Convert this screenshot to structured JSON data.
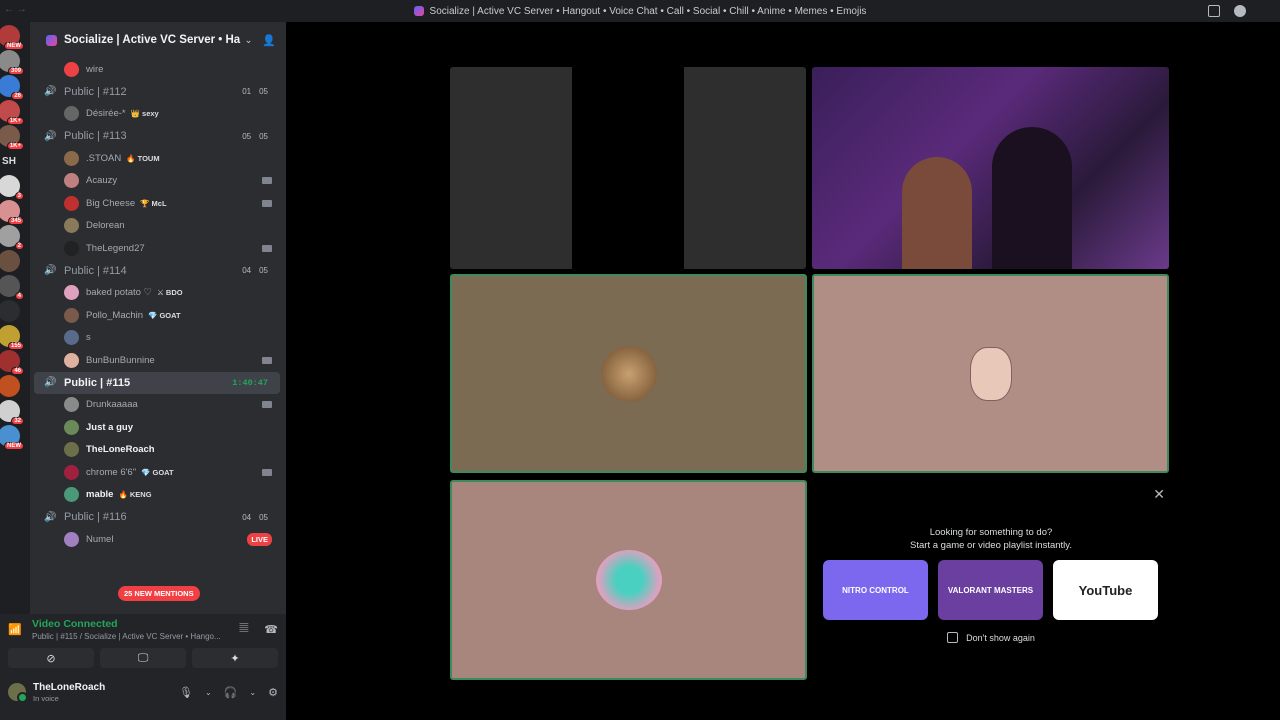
{
  "window": {
    "title": "Socialize | Active VC Server • Hangout • Voice Chat • Call • Social • Chill • Anime • Memes • Emojis"
  },
  "guilds": [
    {
      "badge": "NEW",
      "color": "#b13b3b"
    },
    {
      "badge": "309",
      "color": "#8a8a8a"
    },
    {
      "badge": "26",
      "color": "#3a7bd5"
    },
    {
      "badge": "1K+",
      "color": "#c24a4a"
    },
    {
      "badge": "1K+",
      "color": "#7a5a4a"
    },
    {
      "badge": "",
      "color": "#1e1f22",
      "text": "SH"
    },
    {
      "badge": "3",
      "color": "#d8d8d8"
    },
    {
      "badge": "345",
      "color": "#d89090"
    },
    {
      "badge": "2",
      "color": "#a0a0a0"
    },
    {
      "badge": "",
      "color": "#6a5040"
    },
    {
      "badge": "4",
      "color": "#555"
    },
    {
      "badge": "",
      "color": "#2b2d31"
    },
    {
      "badge": "155",
      "color": "#c0a030"
    },
    {
      "badge": "46",
      "color": "#a03030"
    },
    {
      "badge": "",
      "color": "#c05020"
    },
    {
      "badge": "32",
      "color": "#d0d0d0"
    },
    {
      "badge": "NEW",
      "color": "#4a90d0"
    }
  ],
  "sidebar": {
    "server_name": "Socialize | Active VC Server • Han...",
    "top_members": [
      {
        "name": "wire",
        "color": "#ed4245"
      }
    ],
    "channels": [
      {
        "name": "Public | #112",
        "count_a": "01",
        "count_b": "05",
        "members": [
          {
            "name": "Désirée-*",
            "tag": "👑 sexy",
            "color": "#666",
            "cam": false
          }
        ]
      },
      {
        "name": "Public | #113",
        "count_a": "05",
        "count_b": "05",
        "members": [
          {
            "name": ".STOAN",
            "tag": "🔥 TOUM",
            "color": "#8a6a4a",
            "cam": false
          },
          {
            "name": "Acauzy",
            "tag": "",
            "color": "#c08080",
            "cam": true
          },
          {
            "name": "Big Cheese",
            "tag": "🏆 McL",
            "color": "#c03030",
            "cam": true
          },
          {
            "name": "Delorean",
            "tag": "",
            "color": "#8a7a5a",
            "cam": false
          },
          {
            "name": "TheLegend27",
            "tag": "",
            "color": "#222",
            "cam": true
          }
        ]
      },
      {
        "name": "Public | #114",
        "count_a": "04",
        "count_b": "05",
        "members": [
          {
            "name": "baked potato ♡",
            "tag": "⚔ BDO",
            "color": "#e0a0c0",
            "cam": false
          },
          {
            "name": "Pollo_Machin",
            "tag": "💎 GOAT",
            "color": "#7a5a4a",
            "cam": false
          },
          {
            "name": "s",
            "tag": "",
            "color": "#5a6a8a",
            "cam": false
          },
          {
            "name": "BunBunBunnine",
            "tag": "",
            "color": "#e0b0a0",
            "cam": true
          }
        ]
      },
      {
        "name": "Public | #115",
        "timer": "1:40:47",
        "active": true,
        "members": [
          {
            "name": "Drunkaaaaa",
            "tag": "",
            "color": "#8a8a8a",
            "cam": true,
            "white": false
          },
          {
            "name": "Just a guy",
            "tag": "",
            "color": "#6a8a5a",
            "cam": false,
            "white": true
          },
          {
            "name": "TheLoneRoach",
            "tag": "",
            "color": "#6d6f4b",
            "cam": false,
            "white": true
          },
          {
            "name": "chrome 6'6\"",
            "tag": "💎 GOAT",
            "color": "#a02040",
            "cam": true,
            "white": false
          },
          {
            "name": "mable",
            "tag": "🔥 KENG",
            "color": "#4a9a7a",
            "cam": false,
            "white": true
          }
        ]
      },
      {
        "name": "Public | #116",
        "count_a": "04",
        "count_b": "05",
        "members": [
          {
            "name": "Numel",
            "tag": "",
            "color": "#a080c0",
            "live": "LIVE"
          }
        ]
      }
    ],
    "mentions_pill": "25 NEW MENTIONS"
  },
  "voice": {
    "status": "Video Connected",
    "location": "Public | #115 / Socialize | Active VC Server • Hango..."
  },
  "user": {
    "name": "TheLoneRoach",
    "status": "In voice"
  },
  "activity": {
    "line1": "Looking for something to do?",
    "line2": "Start a game or video playlist instantly.",
    "cards": [
      {
        "label": "NITRO CONTROL",
        "color": "#7b68ee"
      },
      {
        "label": "VALORANT MASTERS",
        "color": "#6a3fa0"
      },
      {
        "label": "YouTube",
        "color": "#ffffff"
      }
    ],
    "dont_show": "Don't show again"
  },
  "tiles": {
    "tile_dark_bg": "#333",
    "tile2_bg": "#7a6b52",
    "tile3_bg": "#b08e86",
    "tile4_bg": "#a8857d",
    "speaking_border": "#3d8a5c"
  }
}
